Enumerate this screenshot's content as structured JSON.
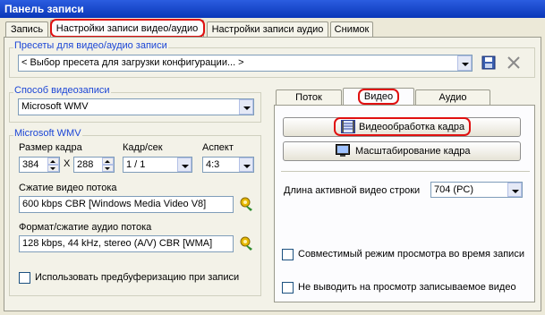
{
  "window": {
    "title": "Панель записи"
  },
  "tabs": [
    "Запись",
    "Настройки записи видео/аудио",
    "Настройки записи аудио",
    "Снимок"
  ],
  "presets": {
    "group_title": "Пресеты для видео/аудио записи",
    "value": "< Выбор пресета для загрузки конфигурации... >"
  },
  "method": {
    "group_title": "Способ видеозаписи",
    "value": "Microsoft WMV"
  },
  "wmv": {
    "group_title": "Microsoft WMV",
    "frame_size_label": "Размер кадра",
    "width": "384",
    "x_sep": "X",
    "height": "288",
    "fps_label": "Кадр/сек",
    "fps_value": "1 / 1",
    "aspect_label": "Аспект",
    "aspect_value": "4:3",
    "video_comp_label": "Сжатие видео потока",
    "video_comp_value": "600 kbps CBR [Windows Media Video V8]",
    "audio_comp_label": "Формат/сжатие аудио потока",
    "audio_comp_value": "128 kbps, 44 kHz, stereo (A/V) CBR [WMA]",
    "prebuffer_label": "Использовать предбуферизацию при записи",
    "prebuffer_checked": false
  },
  "right_tabs": [
    "Поток",
    "Видео",
    "Аудио"
  ],
  "video_tab": {
    "btn_processing": "Видеообработка кадра",
    "btn_scaling": "Масштабирование кадра",
    "line_length_label": "Длина активной видео строки",
    "line_length_value": "704 (PC)",
    "compat_preview_label": "Совместимый режим просмотра во время записи",
    "no_preview_label": "Не выводить на просмотр записываемое видео"
  },
  "colors": {
    "highlight": "#e01010",
    "title_bar": "#0a37b8",
    "group_title": "#1c46d6"
  }
}
